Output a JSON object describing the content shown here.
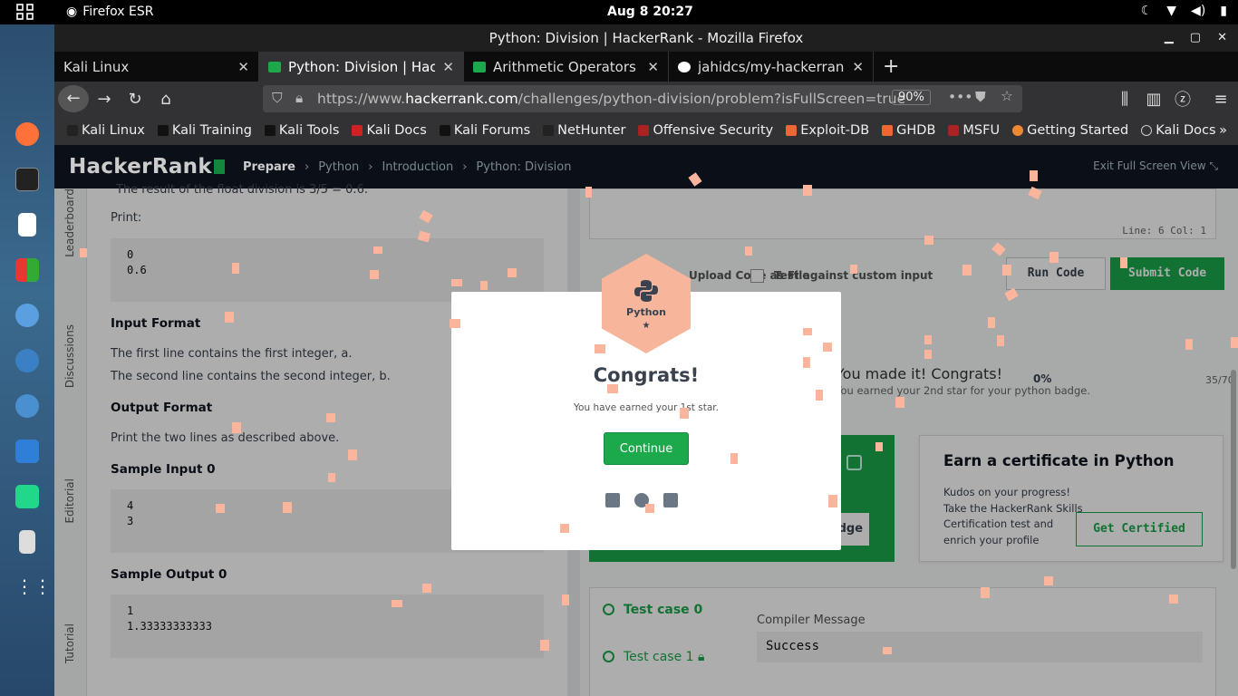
{
  "topbar": {
    "app": "Firefox ESR",
    "clock": "Aug 8  20:27"
  },
  "window": {
    "title": "Python: Division | HackerRank - Mozilla Firefox"
  },
  "tabs": [
    {
      "label": "Kali Linux"
    },
    {
      "label": "Python: Division | HackerR"
    },
    {
      "label": "Arithmetic Operators | Ha"
    },
    {
      "label": "jahidcs/my-hackerrank-so"
    }
  ],
  "url": {
    "prefix": "https://www.",
    "domain": "hackerrank.com",
    "path": "/challenges/python-division/problem?isFullScreen=true",
    "zoom": "90%"
  },
  "bookmarks": [
    "Kali Linux",
    "Kali Training",
    "Kali Tools",
    "Kali Docs",
    "Kali Forums",
    "NetHunter",
    "Offensive Security",
    "Exploit-DB",
    "GHDB",
    "MSFU",
    "Getting Started",
    "Kali Docs"
  ],
  "hr": {
    "logo": "HackerRank",
    "crumbs": [
      "Prepare",
      "Python",
      "Introduction",
      "Python: Division"
    ],
    "exit": "Exit Full Screen View"
  },
  "sidetabs": [
    "Leaderboard",
    "Discussions",
    "Editorial",
    "Tutorial"
  ],
  "problem": {
    "bullet": "The result of the float division is 3/5 = 0.6.",
    "print": "Print:",
    "code1": [
      "0",
      "0.6"
    ],
    "input_h": "Input Format",
    "input_1": "The first line contains the first integer, a.",
    "input_2": "The second line contains the second integer, b.",
    "output_h": "Output Format",
    "output_1": "Print the two lines as described above.",
    "sin_h": "Sample Input 0",
    "sin": [
      "4",
      "3"
    ],
    "sout_h": "Sample Output 0",
    "sout": [
      "1",
      "1.33333333333"
    ]
  },
  "editor": {
    "linecol": "Line: 6 Col: 1",
    "upload": "Upload Code as File",
    "custom": "Test against custom input",
    "run": "Run Code",
    "submit": "Submit Code"
  },
  "progress": {
    "headline": "You made it! Congrats!",
    "sub": "You earned your 2nd star for your python badge.",
    "pct": "0%",
    "ratio": "35/70"
  },
  "share_card": {
    "button": "Badge"
  },
  "cert": {
    "title": "Earn a certificate in Python",
    "desc": "Kudos on your progress! Take the HackerRank Skills Certification test and enrich your profile",
    "button": "Get Certified"
  },
  "results": {
    "tc0": "Test case 0",
    "tc1": "Test case 1",
    "compiler": "Compiler Message",
    "message": "Success"
  },
  "modal": {
    "badge": "Python",
    "star": "★",
    "title": "Congrats!",
    "text": "You have earned your 1st star.",
    "button": "Continue"
  }
}
